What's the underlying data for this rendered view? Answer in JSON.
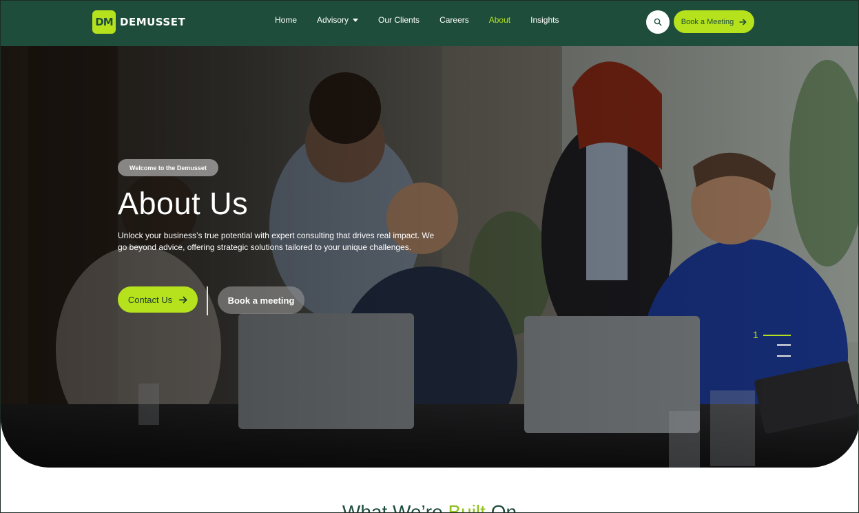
{
  "brand": {
    "logo_mark": "DM",
    "name": "DEMUSSET",
    "accent": "#b5e21c",
    "primary": "#1e4d3c"
  },
  "nav": {
    "items": [
      {
        "label": "Home"
      },
      {
        "label": "Advisory",
        "has_dropdown": true
      },
      {
        "label": "Our Clients"
      },
      {
        "label": "Careers"
      },
      {
        "label": "About",
        "active": true
      },
      {
        "label": "Insights"
      }
    ],
    "search_icon": "search-icon",
    "book_label": "Book a Meeting"
  },
  "hero": {
    "badge": "Welcome to the Demusset",
    "title": "About Us",
    "description": "Unlock your business’s true potential with expert consulting that drives real impact. We go beyond advice, offering strategic solutions tailored to your unique challenges.",
    "contact_label": "Contact Us",
    "meeting_label": "Book a meeting",
    "slide_current": "1",
    "slide_total": 3
  },
  "section": {
    "title_part1": "What We’re ",
    "title_highlight": "Built",
    "title_part2": " On"
  }
}
